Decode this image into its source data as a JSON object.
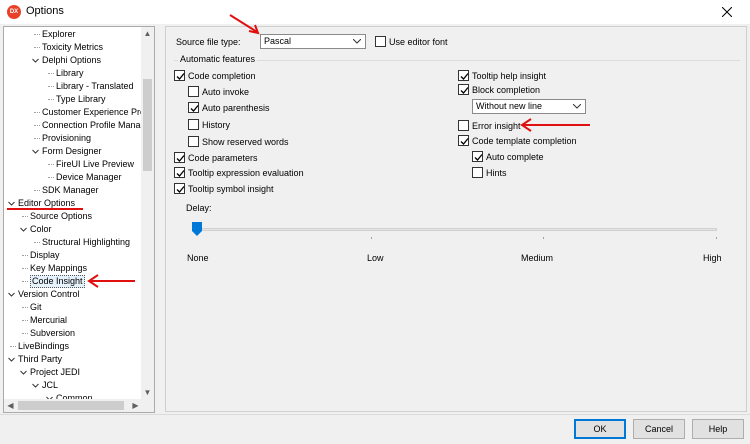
{
  "window": {
    "title": "Options",
    "app_icon_text": "DX",
    "close_icon": "close-icon"
  },
  "tree": {
    "items": [
      {
        "label": "Explorer",
        "level": 2,
        "expander": "none"
      },
      {
        "label": "Toxicity Metrics",
        "level": 2,
        "expander": "none"
      },
      {
        "label": "Delphi Options",
        "level": 2,
        "expander": "expanded"
      },
      {
        "label": "Library",
        "level": 3,
        "expander": "none"
      },
      {
        "label": "Library - Translated",
        "level": 3,
        "expander": "none"
      },
      {
        "label": "Type Library",
        "level": 3,
        "expander": "none"
      },
      {
        "label": "Customer Experience Progr",
        "level": 2,
        "expander": "none"
      },
      {
        "label": "Connection Profile Manage",
        "level": 2,
        "expander": "none"
      },
      {
        "label": "Provisioning",
        "level": 2,
        "expander": "none"
      },
      {
        "label": "Form Designer",
        "level": 2,
        "expander": "expanded"
      },
      {
        "label": "FireUI Live Preview",
        "level": 3,
        "expander": "none"
      },
      {
        "label": "Device Manager",
        "level": 3,
        "expander": "none"
      },
      {
        "label": "SDK Manager",
        "level": 2,
        "expander": "none"
      },
      {
        "label": "Editor Options",
        "level": 0,
        "expander": "expanded"
      },
      {
        "label": "Source Options",
        "level": 1,
        "expander": "none"
      },
      {
        "label": "Color",
        "level": 1,
        "expander": "expanded"
      },
      {
        "label": "Structural Highlighting",
        "level": 2,
        "expander": "none"
      },
      {
        "label": "Display",
        "level": 1,
        "expander": "none"
      },
      {
        "label": "Key Mappings",
        "level": 1,
        "expander": "none"
      },
      {
        "label": "Code Insight",
        "level": 1,
        "expander": "none",
        "selected": true
      },
      {
        "label": "Version Control",
        "level": 0,
        "expander": "expanded"
      },
      {
        "label": "Git",
        "level": 1,
        "expander": "none"
      },
      {
        "label": "Mercurial",
        "level": 1,
        "expander": "none"
      },
      {
        "label": "Subversion",
        "level": 1,
        "expander": "none"
      },
      {
        "label": "LiveBindings",
        "level": 0,
        "expander": "none"
      },
      {
        "label": "Third Party",
        "level": 0,
        "expander": "expanded"
      },
      {
        "label": "Project JEDI",
        "level": 1,
        "expander": "expanded"
      },
      {
        "label": "JCL",
        "level": 2,
        "expander": "expanded"
      },
      {
        "label": "Common",
        "level": 3,
        "expander": "expanded"
      }
    ]
  },
  "source_file_type": {
    "label": "Source file type:",
    "value": "Pascal"
  },
  "use_editor_font": {
    "label": "Use editor font",
    "checked": false
  },
  "automatic_features": {
    "label": "Automatic features",
    "left": [
      {
        "label": "Code completion",
        "checked": true
      },
      {
        "label": "Auto invoke",
        "checked": false
      },
      {
        "label": "Auto parenthesis",
        "checked": true
      },
      {
        "label": "History",
        "checked": false
      },
      {
        "label": "Show reserved words",
        "checked": false
      },
      {
        "label": "Code parameters",
        "checked": true
      },
      {
        "label": "Tooltip expression evaluation",
        "checked": true
      },
      {
        "label": "Tooltip symbol insight",
        "checked": true
      }
    ],
    "right": [
      {
        "label": "Tooltip help insight",
        "checked": true
      },
      {
        "label": "Block completion",
        "checked": true
      },
      {
        "label": "Error insight",
        "checked": false
      },
      {
        "label": "Code template completion",
        "checked": true
      },
      {
        "label": "Auto complete",
        "checked": true
      },
      {
        "label": "Hints",
        "checked": false
      }
    ],
    "block_completion_value": "Without new line"
  },
  "delay": {
    "label": "Delay:",
    "level_fraction": 0,
    "labels": [
      "None",
      "Low",
      "Medium",
      "High"
    ]
  },
  "buttons": {
    "ok": "OK",
    "cancel": "Cancel",
    "help": "Help"
  },
  "colors": {
    "accent": "#0078d7",
    "annotation": "#e01010",
    "selection": "#e5f1fb"
  }
}
